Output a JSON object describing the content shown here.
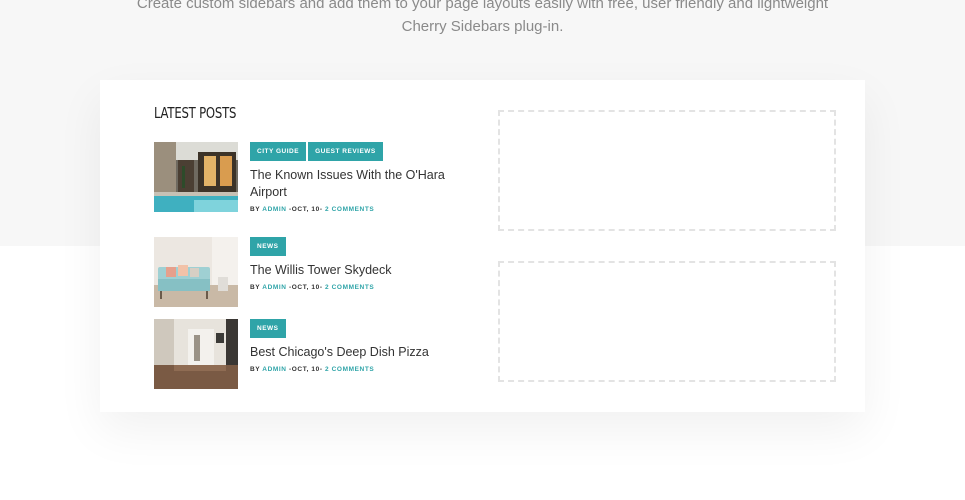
{
  "intro": {
    "line1": "Create custom sidebars and add them to your page layouts easily with free, user friendly and lightweight",
    "line2": "Cherry Sidebars plug-in."
  },
  "widget": {
    "title": "Latest Posts",
    "posts": [
      {
        "tags": [
          "City Guide",
          "Guest Reviews"
        ],
        "title": "The Known Issues With the O'Hara Airport",
        "by": "By",
        "author": "Admin",
        "date": "-Oct, 10-",
        "comments": "2 Comments"
      },
      {
        "tags": [
          "News"
        ],
        "title": "The Willis Tower Skydeck",
        "by": "By",
        "author": "Admin",
        "date": "-Oct, 10-",
        "comments": "2 Comments"
      },
      {
        "tags": [
          "News"
        ],
        "title": "Best Chicago's Deep Dish Pizza",
        "by": "By",
        "author": "Admin",
        "date": "-Oct, 10-",
        "comments": "2 Comments"
      }
    ]
  },
  "colors": {
    "accent": "#2fa4a8",
    "band": "#f7f7f7",
    "placeholder_border": "#e3e3e3"
  }
}
